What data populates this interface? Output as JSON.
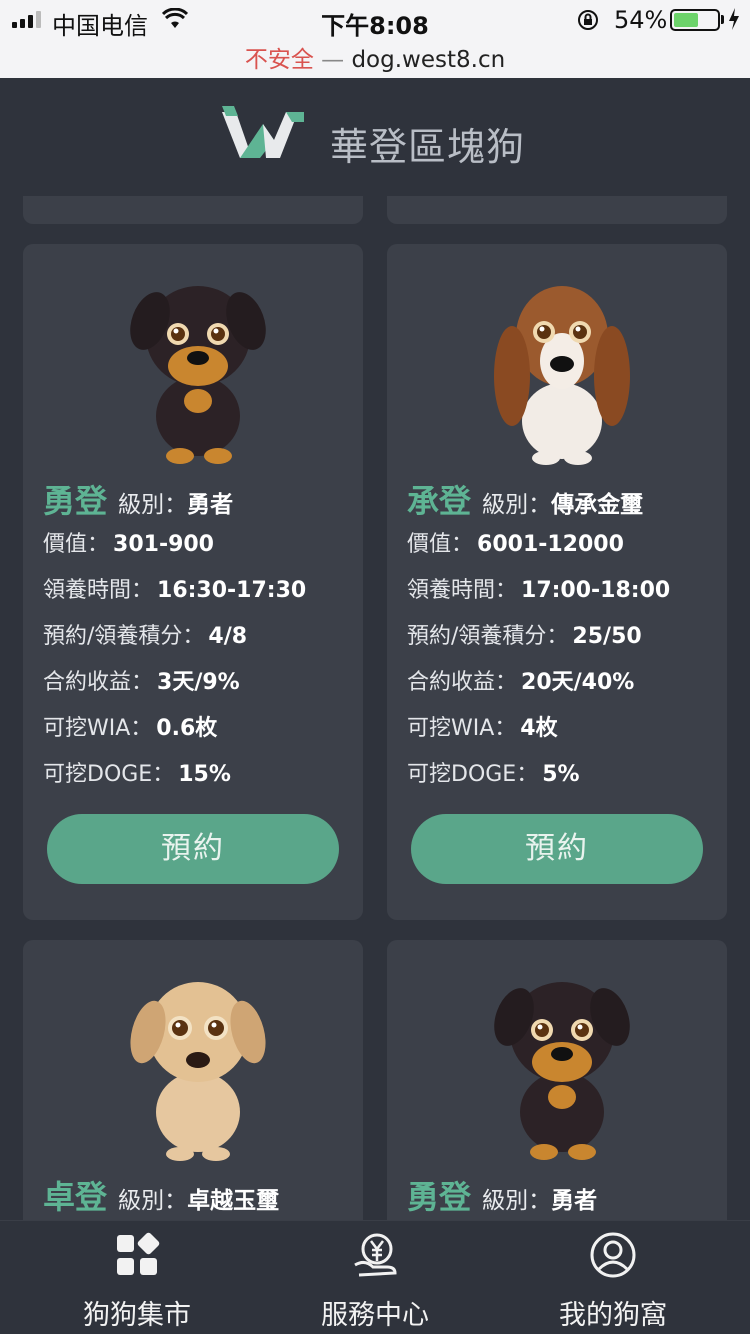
{
  "status_bar": {
    "carrier": "中国电信",
    "time": "下午8:08",
    "battery": "54%"
  },
  "browser": {
    "security": "不安全",
    "separator": "—",
    "domain": "dog.west8.cn"
  },
  "header": {
    "brand": "華登區塊狗"
  },
  "labels": {
    "level": "級別：",
    "price": "價值：",
    "adopt_time": "領養時間：",
    "reserve_points": "預約/領養積分：",
    "contract": "合約收益：",
    "wia": "可挖WIA：",
    "doge": "可挖DOGE："
  },
  "cards": [
    {
      "name": "勇登",
      "level": "勇者",
      "price": "301-900",
      "adopt_time": "16:30-17:30",
      "reserve_points": "4/8",
      "contract": "3天/9%",
      "wia": "0.6枚",
      "doge": "15%",
      "button": "預約"
    },
    {
      "name": "承登",
      "level": "傳承金璽",
      "price": "6001-12000",
      "adopt_time": "17:00-18:00",
      "reserve_points": "25/50",
      "contract": "20天/40%",
      "wia": "4枚",
      "doge": "5%",
      "button": "預約"
    },
    {
      "name": "卓登",
      "level": "卓越玉璽"
    },
    {
      "name": "勇登",
      "level": "勇者"
    }
  ],
  "nav": [
    {
      "label": "狗狗集市",
      "icon": "grid-icon"
    },
    {
      "label": "服務中心",
      "icon": "yuan-service-icon"
    },
    {
      "label": "我的狗窩",
      "icon": "user-circle-icon"
    }
  ],
  "colors": {
    "accent": "#5eb494",
    "button": "#5aa68a",
    "background": "#2f333c",
    "card": "#3c4049"
  }
}
